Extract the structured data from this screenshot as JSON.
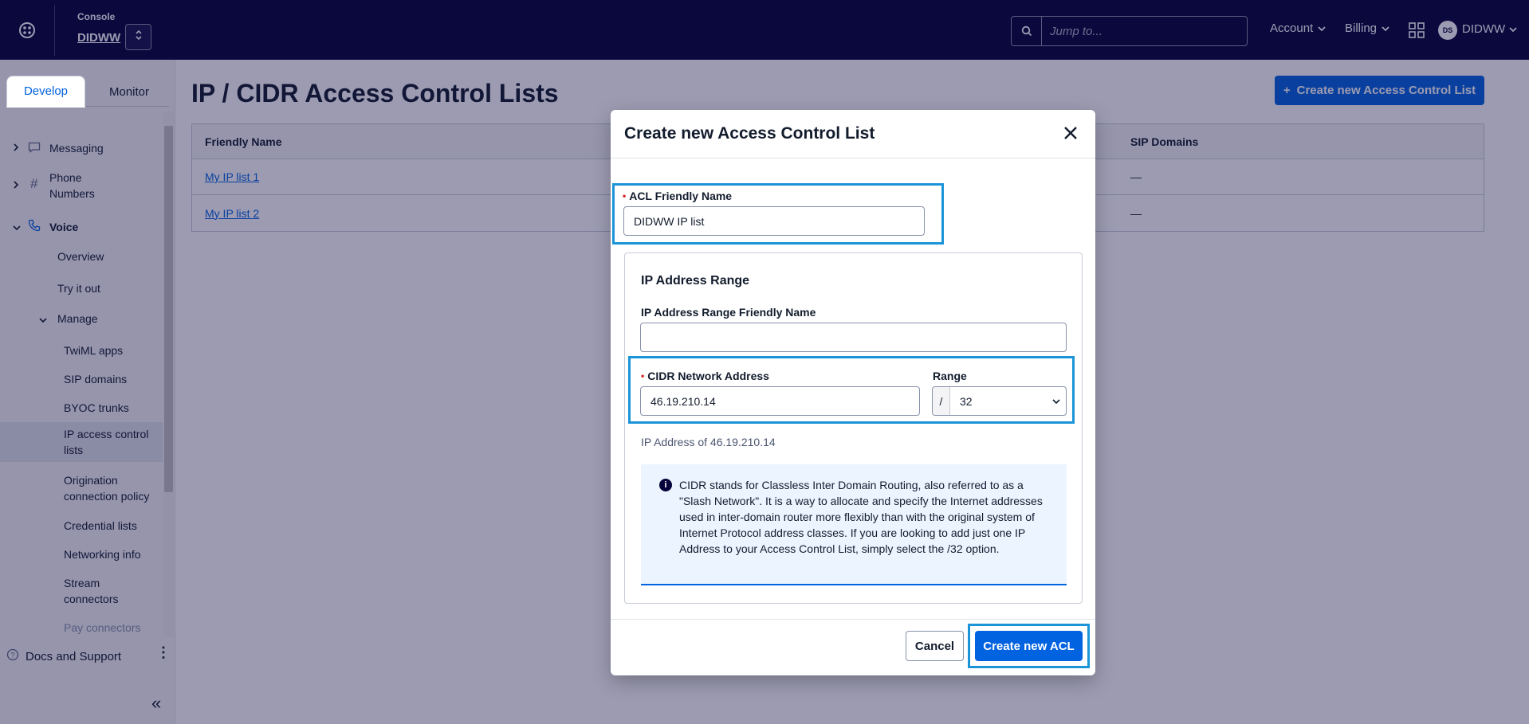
{
  "topbar": {
    "console_label": "Console",
    "account_name": "DIDWW",
    "search_placeholder": "Jump to...",
    "account_menu": "Account",
    "billing_menu": "Billing",
    "user_initials": "DS",
    "user_name": "DIDWW"
  },
  "sidebar": {
    "tabs": [
      "Develop",
      "Monitor"
    ],
    "items": {
      "messaging": "Messaging",
      "phone_numbers": "Phone Numbers",
      "voice": "Voice",
      "overview": "Overview",
      "try_it_out": "Try it out",
      "manage": "Manage",
      "twiml_apps": "TwiML apps",
      "sip_domains": "SIP domains",
      "byoc_trunks": "BYOC trunks",
      "ip_acl": "IP access control lists",
      "origination": "Origination connection policy",
      "credential_lists": "Credential lists",
      "networking_info": "Networking info",
      "stream_connectors": "Stream connectors",
      "pay_connectors": "Pay connectors"
    },
    "docs": "Docs and Support"
  },
  "main": {
    "title": "IP / CIDR Access Control Lists",
    "create_button": "Create new Access Control List",
    "table": {
      "headers": [
        "Friendly Name",
        "SIP Domains"
      ],
      "rows": [
        {
          "name": "My IP list 1",
          "sip": "—"
        },
        {
          "name": "My IP list 2",
          "sip": "—"
        }
      ]
    }
  },
  "modal": {
    "title": "Create new Access Control List",
    "acl_label": "ACL Friendly Name",
    "acl_value": "DIDWW IP list",
    "card_title": "IP Address Range",
    "range_name_label": "IP Address Range Friendly Name",
    "range_name_value": "",
    "cidr_label": "CIDR Network Address",
    "cidr_value": "46.19.210.14",
    "range_label": "Range",
    "range_prefix": "/",
    "range_value": "32",
    "help_text": "IP Address of 46.19.210.14",
    "info_text": "CIDR stands for Classless Inter Domain Routing, also referred to as a \"Slash Network\". It is a way to allocate and specify the Internet addresses used in inter-domain router more flexibly than with the original system of Internet Protocol address classes. If you are looking to add just one IP Address to your Access Control List, simply select the /32 option.",
    "cancel": "Cancel",
    "submit": "Create new ACL"
  },
  "colors": {
    "topbar": "#06033a",
    "primary": "#0263e0",
    "highlight": "#1b95d8"
  }
}
